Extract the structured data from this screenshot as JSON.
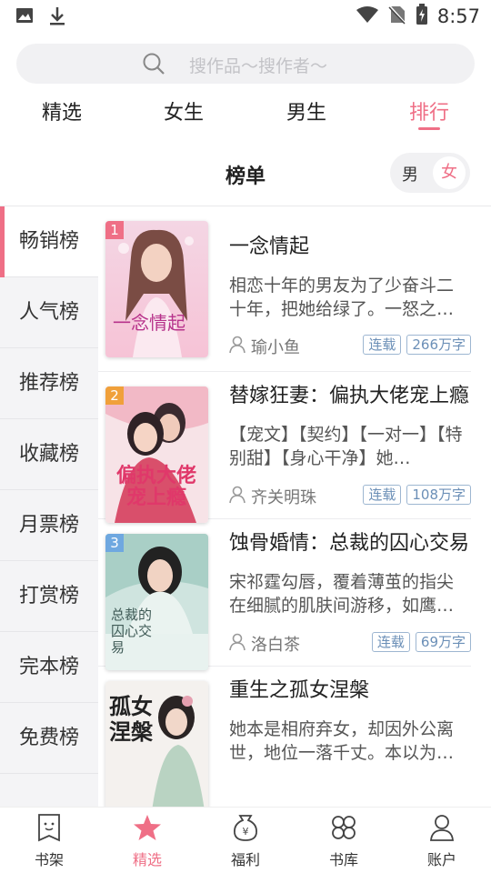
{
  "status": {
    "time": "8:57"
  },
  "search": {
    "placeholder": "搜作品～搜作者～"
  },
  "tabs": [
    {
      "label": "精选"
    },
    {
      "label": "女生"
    },
    {
      "label": "男生"
    },
    {
      "label": "排行"
    }
  ],
  "section": {
    "title": "榜单",
    "gender_male": "男",
    "gender_female": "女"
  },
  "side": [
    {
      "label": "畅销榜"
    },
    {
      "label": "人气榜"
    },
    {
      "label": "推荐榜"
    },
    {
      "label": "收藏榜"
    },
    {
      "label": "月票榜"
    },
    {
      "label": "打赏榜"
    },
    {
      "label": "完本榜"
    },
    {
      "label": "免费榜"
    }
  ],
  "books": [
    {
      "rank": "1",
      "title": "一念情起",
      "desc": "相恋十年的男友为了少奋斗二十年，把她给绿了。一怒之…",
      "author": "瑜小鱼",
      "status": "连载",
      "words": "266万字",
      "cover_text": "一念情起"
    },
    {
      "rank": "2",
      "title": "替嫁狂妻：偏执大佬宠上瘾",
      "desc": "【宠文】【契约】【一对一】【特别甜】【身心干净】她…",
      "author": "齐关明珠",
      "status": "连载",
      "words": "108万字",
      "cover_text": "偏执大佬宠上瘾"
    },
    {
      "rank": "3",
      "title": "蚀骨婚情：总裁的囚心交易",
      "desc": "宋祁霆勾唇，覆着薄茧的指尖在细腻的肌肤间游移，如鹰…",
      "author": "洛白茶",
      "status": "连载",
      "words": "69万字",
      "cover_text": "总裁的囚心交易"
    },
    {
      "rank": "",
      "title": "重生之孤女涅槃",
      "desc": "她本是相府弃女，却因外公离世，地位一落千丈。本以为…",
      "author": "",
      "status": "",
      "words": "",
      "cover_text": "孤女涅槃"
    }
  ],
  "bottom_nav": [
    {
      "label": "书架"
    },
    {
      "label": "精选"
    },
    {
      "label": "福利"
    },
    {
      "label": "书库"
    },
    {
      "label": "账户"
    }
  ],
  "colors": {
    "accent": "#ef6f86",
    "tag": "#6b8fb7",
    "rank1": "#ef6f86",
    "rank2": "#f0a03a",
    "rank3": "#6fa8e0"
  }
}
